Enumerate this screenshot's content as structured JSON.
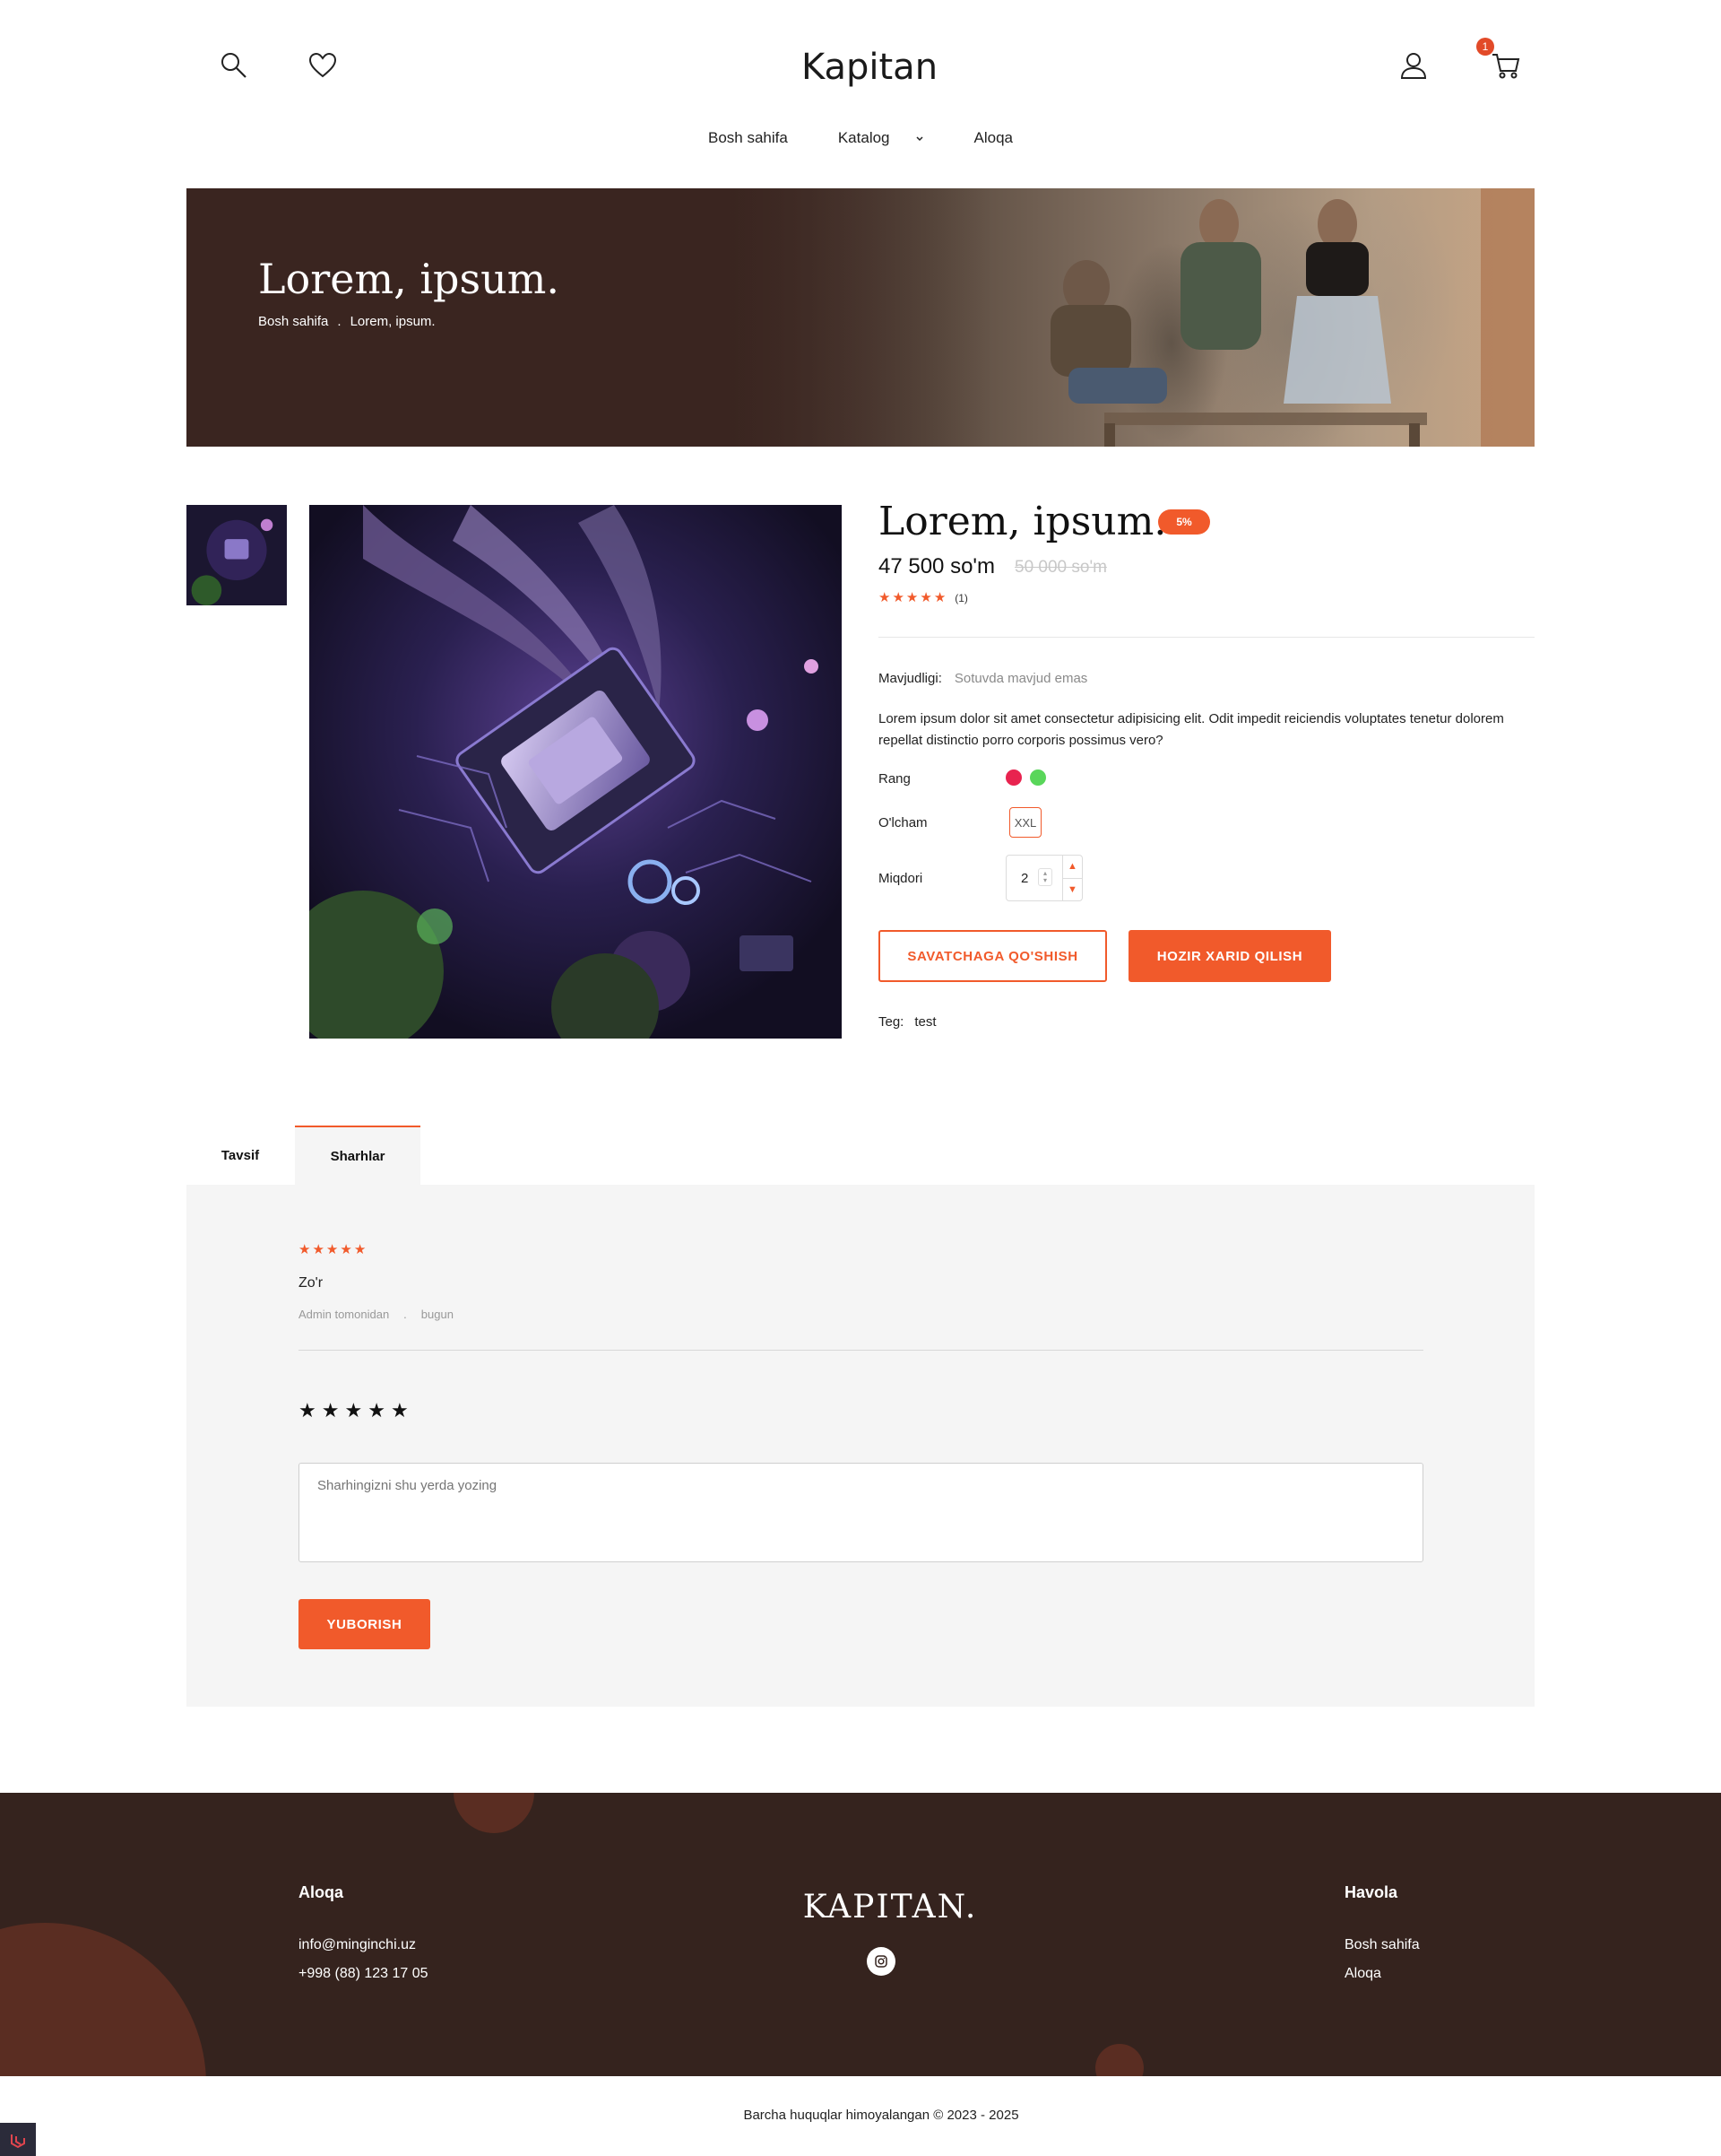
{
  "header": {
    "logo": "Kapitan",
    "cart_count": "1",
    "nav": [
      {
        "label": "Bosh sahifa"
      },
      {
        "label": "Katalog",
        "has_dropdown": true
      },
      {
        "label": "Aloqa"
      }
    ]
  },
  "hero": {
    "title": "Lorem, ipsum.",
    "breadcrumb": [
      "Bosh sahifa",
      ".",
      "Lorem, ipsum."
    ]
  },
  "product": {
    "title": "Lorem, ipsum.",
    "discount": "5%",
    "price": "47 500 so'm",
    "old_price": "50 000 so'm",
    "rating": 5,
    "review_count": "(1)",
    "availability_label": "Mavjudligi:",
    "availability_value": "Sotuvda mavjud emas",
    "description": "Lorem ipsum dolor sit amet consectetur adipisicing elit. Odit impedit reiciendis voluptates tenetur dolorem repellat distinctio porro corporis possimus vero?",
    "color_label": "Rang",
    "colors": [
      "#e8234f",
      "#59d65a"
    ],
    "size_label": "O'lcham",
    "size": "XXL",
    "qty_label": "Miqdori",
    "qty": "2",
    "add_to_cart": "SAVATCHAGA QO'SHISH",
    "buy_now": "HOZIR XARID QILISH",
    "tag_label": "Teg:",
    "tag": "test"
  },
  "tabs": [
    {
      "label": "Tavsif",
      "active": false
    },
    {
      "label": "Sharhlar",
      "active": true
    }
  ],
  "reviews": {
    "items": [
      {
        "rating": 5,
        "text": "Zo'r",
        "author": "Admin tomonidan",
        "sep": ".",
        "date": "bugun"
      }
    ],
    "form_placeholder": "Sharhingizni shu yerda yozing",
    "submit": "YUBORISH"
  },
  "footer": {
    "contact_title": "Aloqa",
    "email": "info@minginchi.uz",
    "phone": "+998 (88) 123 17 05",
    "logo": "KAPITAN.",
    "links_title": "Havola",
    "links": [
      "Bosh sahifa",
      "Aloqa"
    ],
    "copyright": "Barcha huquqlar himoyalangan © 2023 - 2025"
  },
  "colors": {
    "accent": "#f15a2b",
    "hero_bg": "#3a2520",
    "footer_bg": "#35231e",
    "panel_bg": "#f5f5f5"
  },
  "icons": [
    "search-icon",
    "heart-icon",
    "user-icon",
    "cart-icon",
    "chevron-down-icon",
    "instagram-icon",
    "star-icon"
  ]
}
